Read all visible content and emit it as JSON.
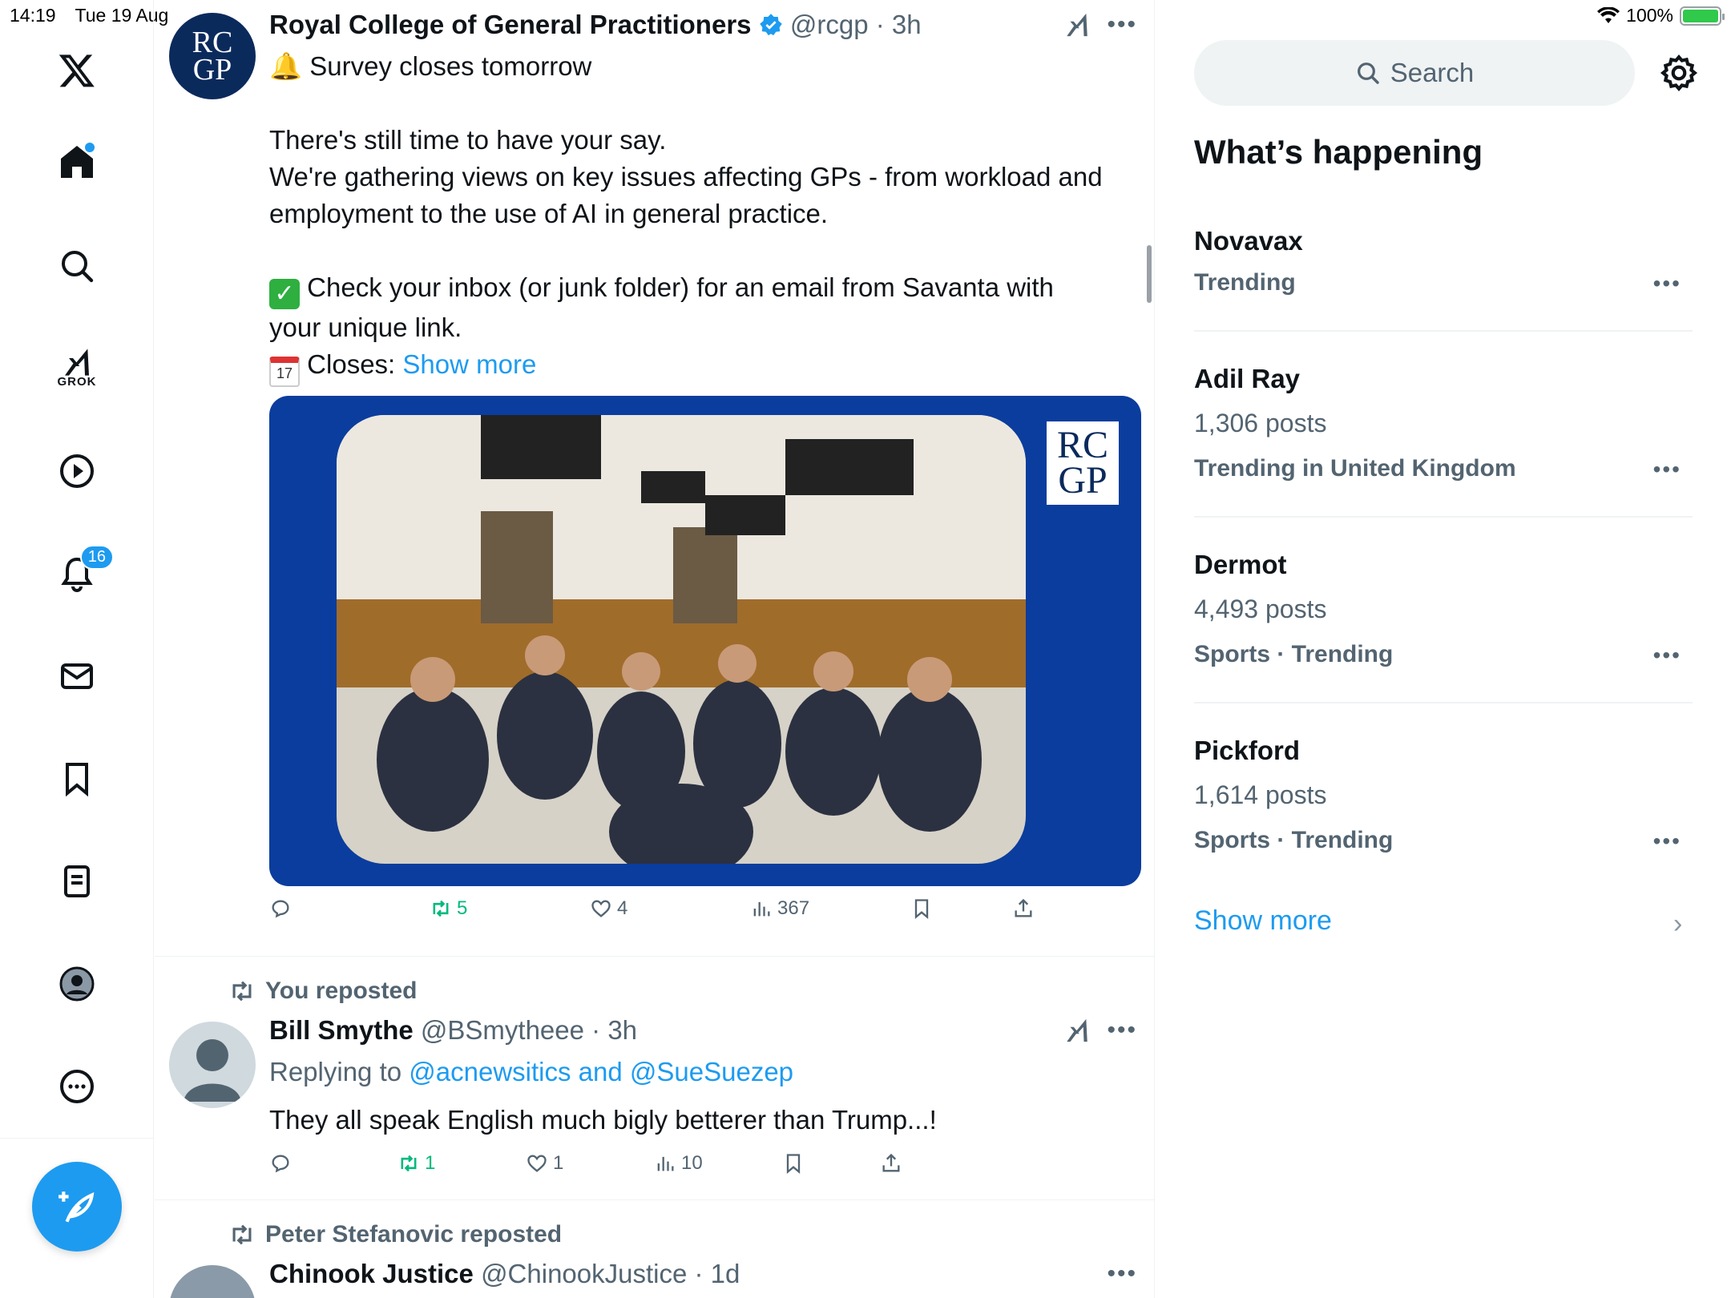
{
  "status_bar": {
    "time": "14:19",
    "date": "Tue 19 Aug",
    "battery": "100%"
  },
  "nav": {
    "grok_label": "GROK",
    "notifications_badge": "16",
    "items": [
      "home-icon",
      "search-icon",
      "grok-icon",
      "video-icon",
      "bell-icon",
      "mail-icon",
      "bookmark-icon",
      "lists-icon",
      "profile-icon",
      "more-icon"
    ]
  },
  "posts": [
    {
      "avatar_text_1": "RC",
      "avatar_text_2": "GP",
      "name": "Royal College of General Practitioners",
      "handle": "@rcgp",
      "time": "· 3h",
      "line1": "Survey closes tomorrow",
      "line2": "There's still time to have your say.",
      "line3": "We're gathering views on key issues affecting GPs - from workload and",
      "line4": "employment to the use of AI in general practice.",
      "line5": "Check your inbox (or junk folder) for an email from Savanta with",
      "line6": "your unique link.",
      "line7_prefix": "Closes: ",
      "line7_link": "Show more",
      "calendar_day": "17",
      "logo_1": "RC",
      "logo_2": "GP",
      "retweets": "5",
      "likes": "4",
      "views": "367"
    },
    {
      "repost_label": "You reposted",
      "name": "Bill Smythe",
      "handle": "@BSmytheee",
      "time": "· 3h",
      "replying_prefix": "Replying to ",
      "replying_to": "@acnewsitics and @SueSuezep",
      "text": "They all speak English much bigly betterer than Trump...!",
      "retweets": "1",
      "likes": "1",
      "views": "10"
    },
    {
      "repost_label": "Peter Stefanovic reposted",
      "name": "Chinook Justice",
      "handle": "@ChinookJustice",
      "time": "· 1d"
    }
  ],
  "search": {
    "placeholder": "Search"
  },
  "whats_happening": {
    "title": "What’s happening",
    "trends": [
      {
        "name": "Novavax",
        "sub": "",
        "meta": "Trending"
      },
      {
        "name": "Adil Ray",
        "sub": "1,306 posts",
        "meta": "Trending in United Kingdom"
      },
      {
        "name": "Dermot",
        "sub": "4,493 posts",
        "meta": "Sports · Trending"
      },
      {
        "name": "Pickford",
        "sub": "1,614 posts",
        "meta": "Sports · Trending"
      }
    ],
    "show_more": "Show more"
  },
  "colors": {
    "accent": "#1d9bf0",
    "retweet": "#00ba7c",
    "media_bg": "#0a3d9e"
  }
}
